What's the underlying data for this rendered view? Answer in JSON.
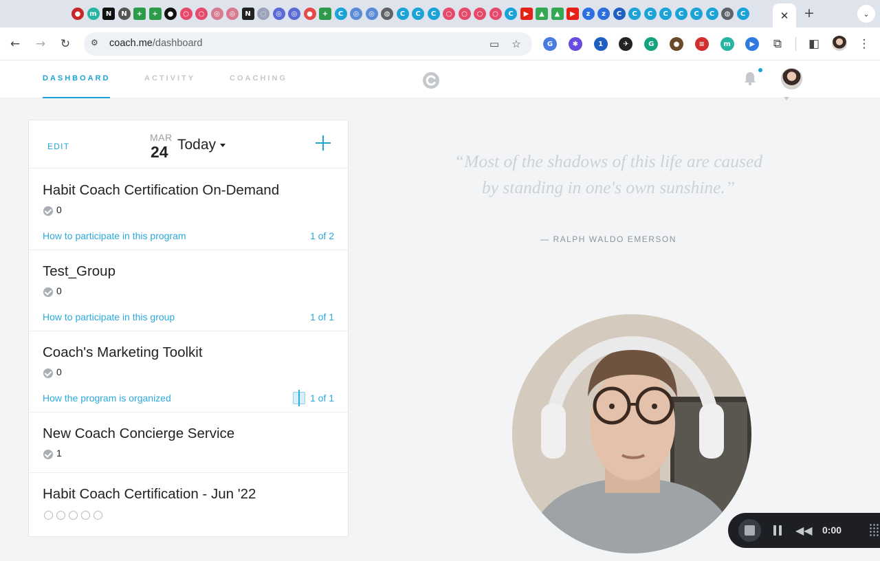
{
  "browser": {
    "tab_favicons": [
      {
        "name": "record-favicon-icon",
        "color": "#c62828",
        "glyph": "●",
        "shape": "round"
      },
      {
        "name": "m-favicon-icon",
        "color": "#26b5a3",
        "glyph": "m",
        "shape": "round"
      },
      {
        "name": "nb-favicon-icon",
        "color": "#111111",
        "glyph": "N",
        "shape": "sq"
      },
      {
        "name": "notion-favicon-icon",
        "color": "#555555",
        "glyph": "N",
        "shape": "round"
      },
      {
        "name": "plus-favicon-icon",
        "color": "#2e9b4b",
        "glyph": "+",
        "shape": "sq"
      },
      {
        "name": "plus-favicon-icon",
        "color": "#2e9b4b",
        "glyph": "+",
        "shape": "sq"
      },
      {
        "name": "medium-favicon-icon",
        "color": "#111111",
        "glyph": "●",
        "shape": "round"
      },
      {
        "name": "ring-favicon-icon",
        "color": "#e64a6b",
        "glyph": "○",
        "shape": "round"
      },
      {
        "name": "ring-favicon-icon",
        "color": "#e64a6b",
        "glyph": "○",
        "shape": "round"
      },
      {
        "name": "gear-favicon-icon",
        "color": "#d77a8f",
        "glyph": "◎",
        "shape": "round"
      },
      {
        "name": "gear-favicon-icon",
        "color": "#d77a8f",
        "glyph": "◎",
        "shape": "round"
      },
      {
        "name": "notion-favicon-icon",
        "color": "#222222",
        "glyph": "N",
        "shape": "sq"
      },
      {
        "name": "dots-favicon-icon",
        "color": "#9aa3b8",
        "glyph": "◌",
        "shape": "round"
      },
      {
        "name": "loop-favicon-icon",
        "color": "#5b6bd6",
        "glyph": "◎",
        "shape": "round"
      },
      {
        "name": "loop-favicon-icon",
        "color": "#5b6bd6",
        "glyph": "◎",
        "shape": "round"
      },
      {
        "name": "cloud-favicon-icon",
        "color": "#e34b4b",
        "glyph": "●",
        "shape": "round"
      },
      {
        "name": "plus-favicon-icon",
        "color": "#2e9b4b",
        "glyph": "+",
        "shape": "sq"
      },
      {
        "name": "coach-favicon-icon",
        "color": "#1ba3d8",
        "glyph": "C",
        "shape": "round"
      },
      {
        "name": "loop-favicon-icon",
        "color": "#5b8bd6",
        "glyph": "◎",
        "shape": "round"
      },
      {
        "name": "loop-favicon-icon",
        "color": "#5b8bd6",
        "glyph": "◎",
        "shape": "round"
      },
      {
        "name": "globe-favicon-icon",
        "color": "#5f6368",
        "glyph": "◍",
        "shape": "round"
      },
      {
        "name": "coach-favicon-icon",
        "color": "#1ba3d8",
        "glyph": "C",
        "shape": "round"
      },
      {
        "name": "coach-favicon-icon",
        "color": "#1ba3d8",
        "glyph": "C",
        "shape": "round"
      },
      {
        "name": "coach-favicon-icon",
        "color": "#1ba3d8",
        "glyph": "C",
        "shape": "round"
      },
      {
        "name": "ring-favicon-icon",
        "color": "#e64a6b",
        "glyph": "○",
        "shape": "round"
      },
      {
        "name": "ring-favicon-icon",
        "color": "#e64a6b",
        "glyph": "○",
        "shape": "round"
      },
      {
        "name": "ring-favicon-icon",
        "color": "#e64a6b",
        "glyph": "○",
        "shape": "round"
      },
      {
        "name": "ring-favicon-icon",
        "color": "#e64a6b",
        "glyph": "○",
        "shape": "round"
      },
      {
        "name": "coach-favicon-icon",
        "color": "#1ba3d8",
        "glyph": "C",
        "shape": "round"
      },
      {
        "name": "youtube-favicon-icon",
        "color": "#e62117",
        "glyph": "▶",
        "shape": "sq"
      },
      {
        "name": "drive-favicon-icon",
        "color": "#34a853",
        "glyph": "▲",
        "shape": "sq"
      },
      {
        "name": "drive-favicon-icon",
        "color": "#34a853",
        "glyph": "▲",
        "shape": "sq"
      },
      {
        "name": "youtube-favicon-icon",
        "color": "#e62117",
        "glyph": "▶",
        "shape": "sq"
      },
      {
        "name": "zoom-favicon-icon",
        "color": "#2d6fe0",
        "glyph": "z",
        "shape": "round"
      },
      {
        "name": "zoom-favicon-icon",
        "color": "#2d6fe0",
        "glyph": "z",
        "shape": "round"
      },
      {
        "name": "coach-dark-favicon-icon",
        "color": "#1f5fbf",
        "glyph": "C",
        "shape": "round"
      },
      {
        "name": "coach-favicon-icon",
        "color": "#1ba3d8",
        "glyph": "C",
        "shape": "round"
      },
      {
        "name": "coach-favicon-icon",
        "color": "#1ba3d8",
        "glyph": "C",
        "shape": "round"
      },
      {
        "name": "coach-favicon-icon",
        "color": "#1ba3d8",
        "glyph": "C",
        "shape": "round"
      },
      {
        "name": "coach-favicon-icon",
        "color": "#1ba3d8",
        "glyph": "C",
        "shape": "round"
      },
      {
        "name": "coach-favicon-icon",
        "color": "#1ba3d8",
        "glyph": "C",
        "shape": "round"
      },
      {
        "name": "coach-favicon-icon",
        "color": "#1ba3d8",
        "glyph": "C",
        "shape": "round"
      },
      {
        "name": "globe-favicon-icon",
        "color": "#5f6368",
        "glyph": "◍",
        "shape": "round"
      },
      {
        "name": "coach-favicon-icon",
        "color": "#1ba3d8",
        "glyph": "C",
        "shape": "round"
      }
    ],
    "active_tab_close": "✕",
    "new_tab": "+",
    "url_host": "coach.me",
    "url_path": "/dashboard",
    "extensions": [
      {
        "name": "translate-extension-icon",
        "color": "#4a7be0",
        "glyph": "G"
      },
      {
        "name": "asterisk-extension-icon",
        "color": "#6a4be0",
        "glyph": "✱"
      },
      {
        "name": "onepassword-extension-icon",
        "color": "#1f5fbf",
        "glyph": "1"
      },
      {
        "name": "send-extension-icon",
        "color": "#222222",
        "glyph": "✈"
      },
      {
        "name": "grammarly-extension-icon",
        "color": "#14a37f",
        "glyph": "G"
      },
      {
        "name": "cookie-extension-icon",
        "color": "#6b4a2b",
        "glyph": "●"
      },
      {
        "name": "stack-extension-icon",
        "color": "#d32f2f",
        "glyph": "≡"
      },
      {
        "name": "m-extension-icon",
        "color": "#26b5a3",
        "glyph": "m"
      },
      {
        "name": "play-extension-icon",
        "color": "#2d7be0",
        "glyph": "▶"
      }
    ]
  },
  "nav": {
    "tabs": [
      {
        "label": "DASHBOARD"
      },
      {
        "label": "ACTIVITY"
      },
      {
        "label": "COACHING"
      }
    ]
  },
  "card": {
    "edit_label": "EDIT",
    "month": "MAR",
    "day": "24",
    "today_label": "Today",
    "items": [
      {
        "title": "Habit Coach Certification On-Demand",
        "count": "0",
        "link": "How to participate in this program",
        "progress": "1 of 2"
      },
      {
        "title": "Test_Group",
        "count": "0",
        "link": "How to participate in this group",
        "progress": "1 of 1"
      },
      {
        "title": "Coach's Marketing Toolkit",
        "count": "0",
        "link": "How the program is organized",
        "progress": "1 of 1"
      },
      {
        "title": "New Coach Concierge Service",
        "count": "1"
      },
      {
        "title": "Habit Coach Certification - Jun '22"
      }
    ]
  },
  "quote": {
    "text": "“Most of the shadows of this life are caused by standing in one's own sunshine.”",
    "author": "— RALPH WALDO EMERSON"
  },
  "recorder": {
    "time": "0:00"
  },
  "colors": {
    "accent": "#1ba3d8",
    "link": "#2ba9dc"
  }
}
